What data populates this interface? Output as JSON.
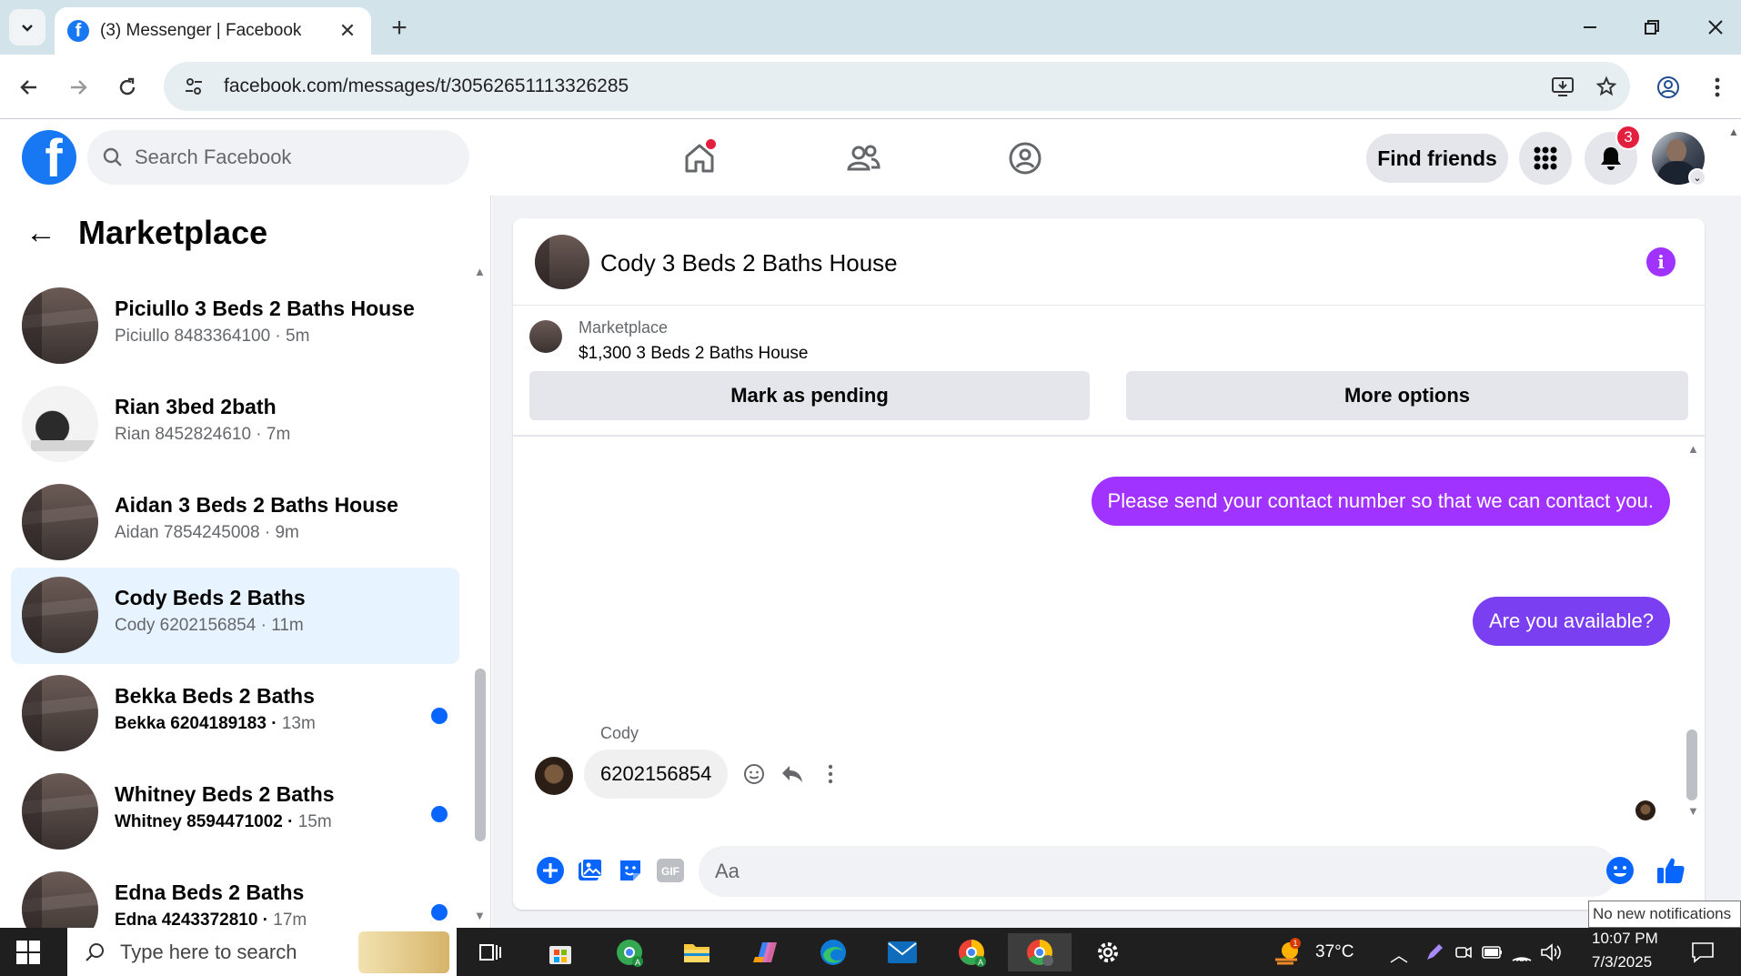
{
  "browser": {
    "tab_title": "(3) Messenger | Facebook",
    "url": "facebook.com/messages/t/30562651113326285"
  },
  "fb": {
    "search_placeholder": "Search Facebook",
    "find_friends": "Find friends",
    "notification_count": "3"
  },
  "sidebar": {
    "title": "Marketplace",
    "conversations": [
      {
        "name": "Piciullo 3 Beds 2 Baths House",
        "sub": "Piciullo 8483364100",
        "time": "5m",
        "unread": false,
        "active": false
      },
      {
        "name": "Rian 3bed 2bath",
        "sub": "Rian 8452824610",
        "time": "7m",
        "unread": false,
        "active": false
      },
      {
        "name": "Aidan 3 Beds 2 Baths House",
        "sub": "Aidan 7854245008",
        "time": "9m",
        "unread": false,
        "active": false
      },
      {
        "name": "Cody Beds 2 Baths",
        "sub": "Cody 6202156854",
        "time": "11m",
        "unread": false,
        "active": true
      },
      {
        "name": "Bekka Beds 2 Baths",
        "sub": "Bekka 6204189183",
        "time": "13m",
        "unread": true,
        "active": false
      },
      {
        "name": "Whitney Beds 2 Baths",
        "sub": "Whitney 8594471002",
        "time": "15m",
        "unread": true,
        "active": false
      },
      {
        "name": "Edna Beds 2 Baths",
        "sub": "Edna 4243372810",
        "time": "17m",
        "unread": true,
        "active": false
      }
    ]
  },
  "chat": {
    "title": "Cody 3 Beds 2 Baths House",
    "listing_label": "Marketplace",
    "listing_title": "$1,300 3 Beds 2 Baths House",
    "mark_pending": "Mark as pending",
    "more_options": "More options",
    "messages": {
      "out1": "Please send your contact number so that we can contact you.",
      "out2": "Are you available?",
      "in_sender": "Cody",
      "in1": "6202156854"
    },
    "composer_placeholder": "Aa"
  },
  "tooltip": "No new notifications",
  "taskbar": {
    "search_placeholder": "Type here to search",
    "weather": "37°C",
    "time": "10:07 PM",
    "date": "7/3/2025",
    "weather_badge": "1"
  },
  "colors": {
    "fb_blue": "#1877f2",
    "messenger_purple": "#a033ff",
    "unread_dot": "#0866ff",
    "active_row": "#e7f3ff"
  }
}
